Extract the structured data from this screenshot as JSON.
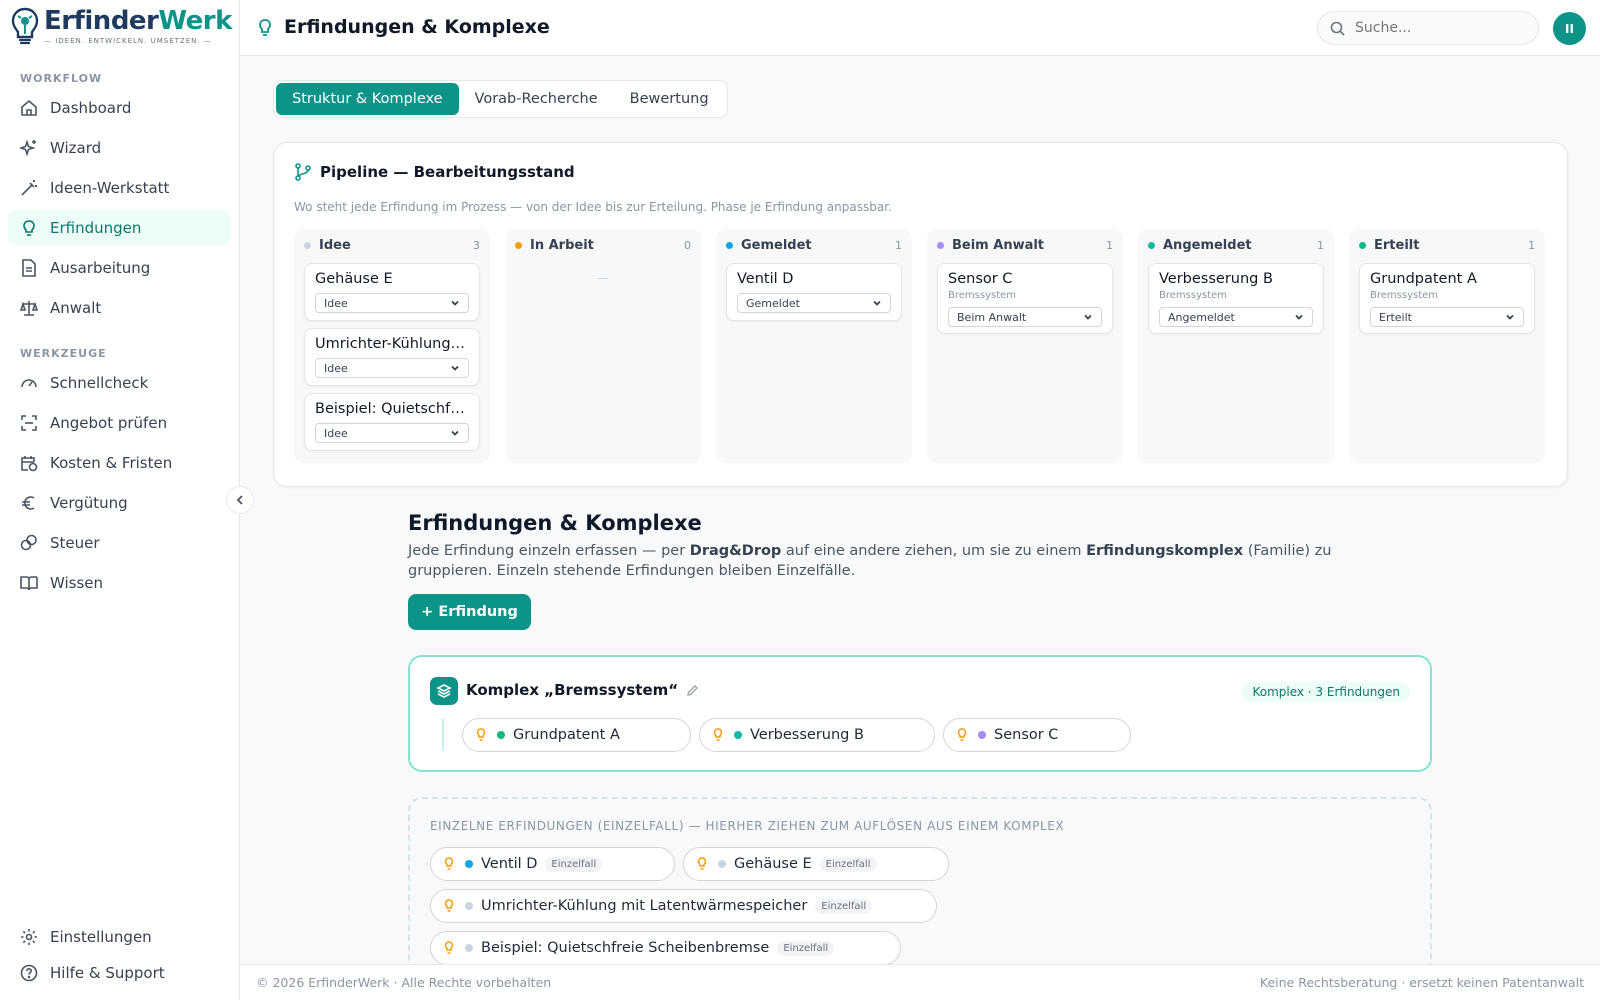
{
  "app": {
    "logo_part1": "Erfinder",
    "logo_part2": "Werk",
    "tagline": "— IDEEN. ENTWICKELN. UMSETZEN. —"
  },
  "sidebar": {
    "workflow_title": "WORKFLOW",
    "tools_title": "WERKZEUGE",
    "workflow": [
      {
        "label": "Dashboard",
        "icon": "home-icon"
      },
      {
        "label": "Wizard",
        "icon": "sparkles-icon"
      },
      {
        "label": "Ideen-Werkstatt",
        "icon": "magic-wand-icon"
      },
      {
        "label": "Erfindungen",
        "icon": "lightbulb-icon",
        "active": true
      },
      {
        "label": "Ausarbeitung",
        "icon": "document-icon"
      },
      {
        "label": "Anwalt",
        "icon": "scale-icon"
      }
    ],
    "tools": [
      {
        "label": "Schnellcheck",
        "icon": "gauge-icon"
      },
      {
        "label": "Angebot prüfen",
        "icon": "scan-icon"
      },
      {
        "label": "Kosten & Fristen",
        "icon": "calendar-clock-icon"
      },
      {
        "label": "Vergütung",
        "icon": "euro-icon"
      },
      {
        "label": "Steuer",
        "icon": "coins-icon"
      },
      {
        "label": "Wissen",
        "icon": "book-icon"
      }
    ],
    "settings": "Einstellungen",
    "help": "Hilfe & Support"
  },
  "header": {
    "title": "Erfindungen & Komplexe",
    "search_placeholder": "Suche...",
    "avatar": "II"
  },
  "tabs": [
    "Struktur & Komplexe",
    "Vorab-Recherche",
    "Bewertung"
  ],
  "pipeline": {
    "title": "Pipeline — Bearbeitungsstand",
    "subtitle": "Wo steht jede Erfindung im Prozess — von der Idee bis zur Erteilung. Phase je Erfindung anpassbar.",
    "empty": "—",
    "columns": [
      {
        "name": "Idee",
        "count": "3",
        "color": "#cbd5e1",
        "cards": [
          {
            "name": "Gehäuse E",
            "sub": "",
            "phase": "Idee"
          },
          {
            "name": "Umrichter-Kühlung mit Latentwärmespeicher",
            "sub": "",
            "phase": "Idee"
          },
          {
            "name": "Beispiel: Quietschfreie Scheibenbremse",
            "sub": "",
            "phase": "Idee"
          }
        ]
      },
      {
        "name": "In Arbeit",
        "count": "0",
        "color": "#f59e0b",
        "cards": []
      },
      {
        "name": "Gemeldet",
        "count": "1",
        "color": "#0ea5e9",
        "cards": [
          {
            "name": "Ventil D",
            "sub": "",
            "phase": "Gemeldet"
          }
        ]
      },
      {
        "name": "Beim Anwalt",
        "count": "1",
        "color": "#a78bfa",
        "cards": [
          {
            "name": "Sensor C",
            "sub": "Bremssystem",
            "phase": "Beim Anwalt"
          }
        ]
      },
      {
        "name": "Angemeldet",
        "count": "1",
        "color": "#14b8a6",
        "cards": [
          {
            "name": "Verbesserung B",
            "sub": "Bremssystem",
            "phase": "Angemeldet"
          }
        ]
      },
      {
        "name": "Erteilt",
        "count": "1",
        "color": "#10b981",
        "cards": [
          {
            "name": "Grundpatent A",
            "sub": "Bremssystem",
            "phase": "Erteilt"
          }
        ]
      }
    ]
  },
  "section": {
    "title": "Erfindungen & Komplexe",
    "desc_1": "Jede Erfindung einzeln erfassen — per ",
    "desc_b1": "Drag&Drop",
    "desc_2": " auf eine andere ziehen, um sie zu einem ",
    "desc_b2": "Erfindungskomplex",
    "desc_3": " (Familie) zu gruppieren. Einzeln stehende Erfindungen bleiben Einzelfälle.",
    "add_button": "+ Erfindung"
  },
  "complex": {
    "title": "Komplex „Bremssystem“",
    "badge": "Komplex · 3 Erfindungen",
    "members": [
      {
        "name": "Grundpatent A",
        "dot": "#10b981"
      },
      {
        "name": "Verbesserung B",
        "dot": "#14b8a6"
      },
      {
        "name": "Sensor C",
        "dot": "#a78bfa"
      }
    ]
  },
  "singles": {
    "title": "EINZELNE ERFINDUNGEN (EINZELFALL) — HIERHER ZIEHEN ZUM AUFLÖSEN AUS EINEM KOMPLEX",
    "tag": "Einzelfall",
    "items": [
      {
        "name": "Ventil D",
        "dot": "#0ea5e9"
      },
      {
        "name": "Gehäuse E",
        "dot": "#cbd5e1"
      },
      {
        "name": "Umrichter-Kühlung mit Latentwärmespeicher",
        "dot": "#cbd5e1"
      },
      {
        "name": "Beispiel: Quietschfreie Scheibenbremse",
        "dot": "#cbd5e1"
      }
    ]
  },
  "footer": {
    "left": "© 2026 ErfinderWerk · Alle Rechte vorbehalten",
    "right": "Keine Rechtsberatung · ersetzt keinen Patentanwalt"
  }
}
